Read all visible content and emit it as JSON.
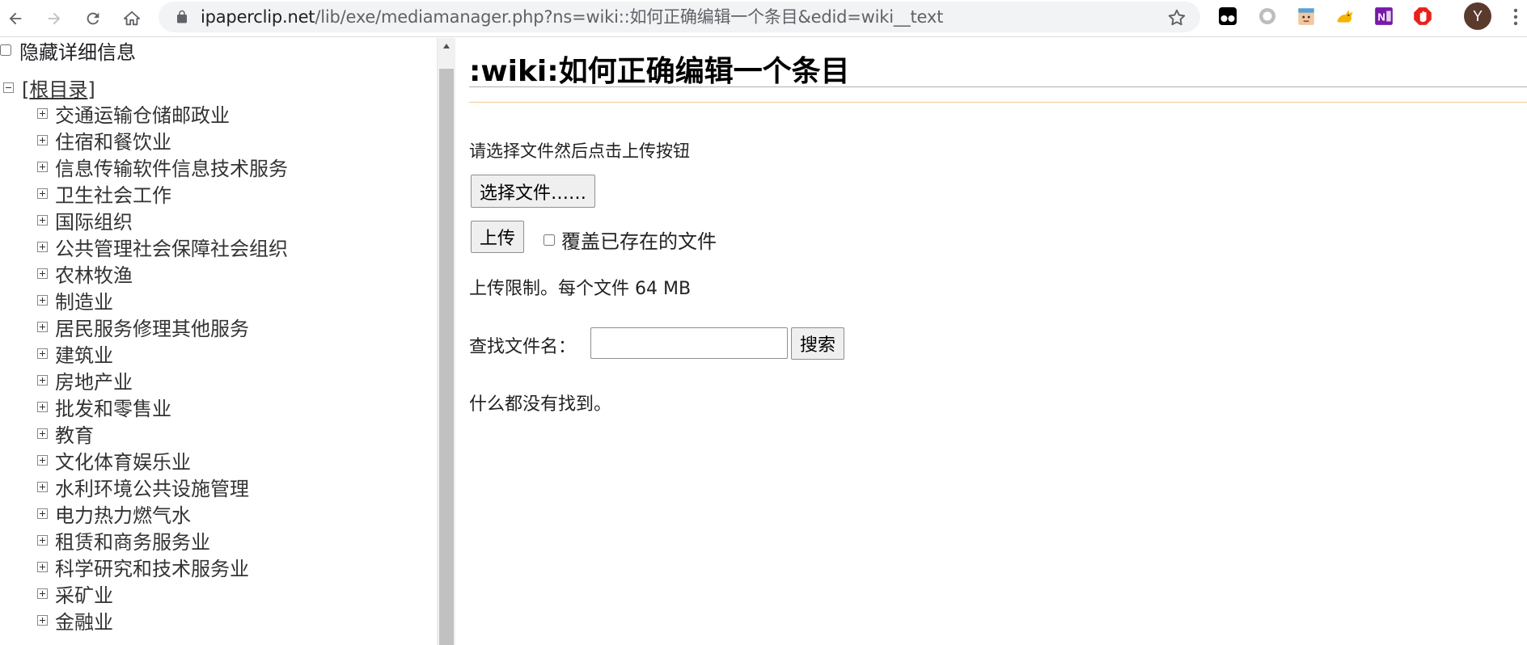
{
  "browser": {
    "url_host": "ipaperclip.net",
    "url_path": "/lib/exe/mediamanager.php?ns=wiki::如何正确编辑一个条目&edid=wiki__text",
    "profile_initial": "Y",
    "extensions": [
      "tampermonkey-icon",
      "circle-extension-icon",
      "face-extension-icon",
      "cat-extension-icon",
      "onenote-icon",
      "adblock-icon"
    ]
  },
  "sidebar": {
    "hide_details_label": "隐藏详细信息",
    "root_open": "[",
    "root_label": "根目录",
    "root_close": "]",
    "items": [
      "交通运输仓储邮政业",
      "住宿和餐饮业",
      "信息传输软件信息技术服务",
      "卫生社会工作",
      "国际组织",
      "公共管理社会保障社会组织",
      "农林牧渔",
      "制造业",
      "居民服务修理其他服务",
      "建筑业",
      "房地产业",
      "批发和零售业",
      "教育",
      "文化体育娱乐业",
      "水利环境公共设施管理",
      "电力热力燃气水",
      "租赁和商务服务业",
      "科学研究和技术服务业",
      "采矿业",
      "金融业"
    ]
  },
  "main": {
    "title": ":wiki:如何正确编辑一个条目",
    "upload_instruction": "请选择文件然后点击上传按钮",
    "choose_file_label": "选择文件……",
    "upload_label": "上传",
    "overwrite_label": "覆盖已存在的文件",
    "upload_limit": "上传限制。每个文件 64 MB",
    "search_label": "查找文件名：",
    "search_value": "",
    "search_button": "搜索",
    "no_results": "什么都没有找到。"
  }
}
